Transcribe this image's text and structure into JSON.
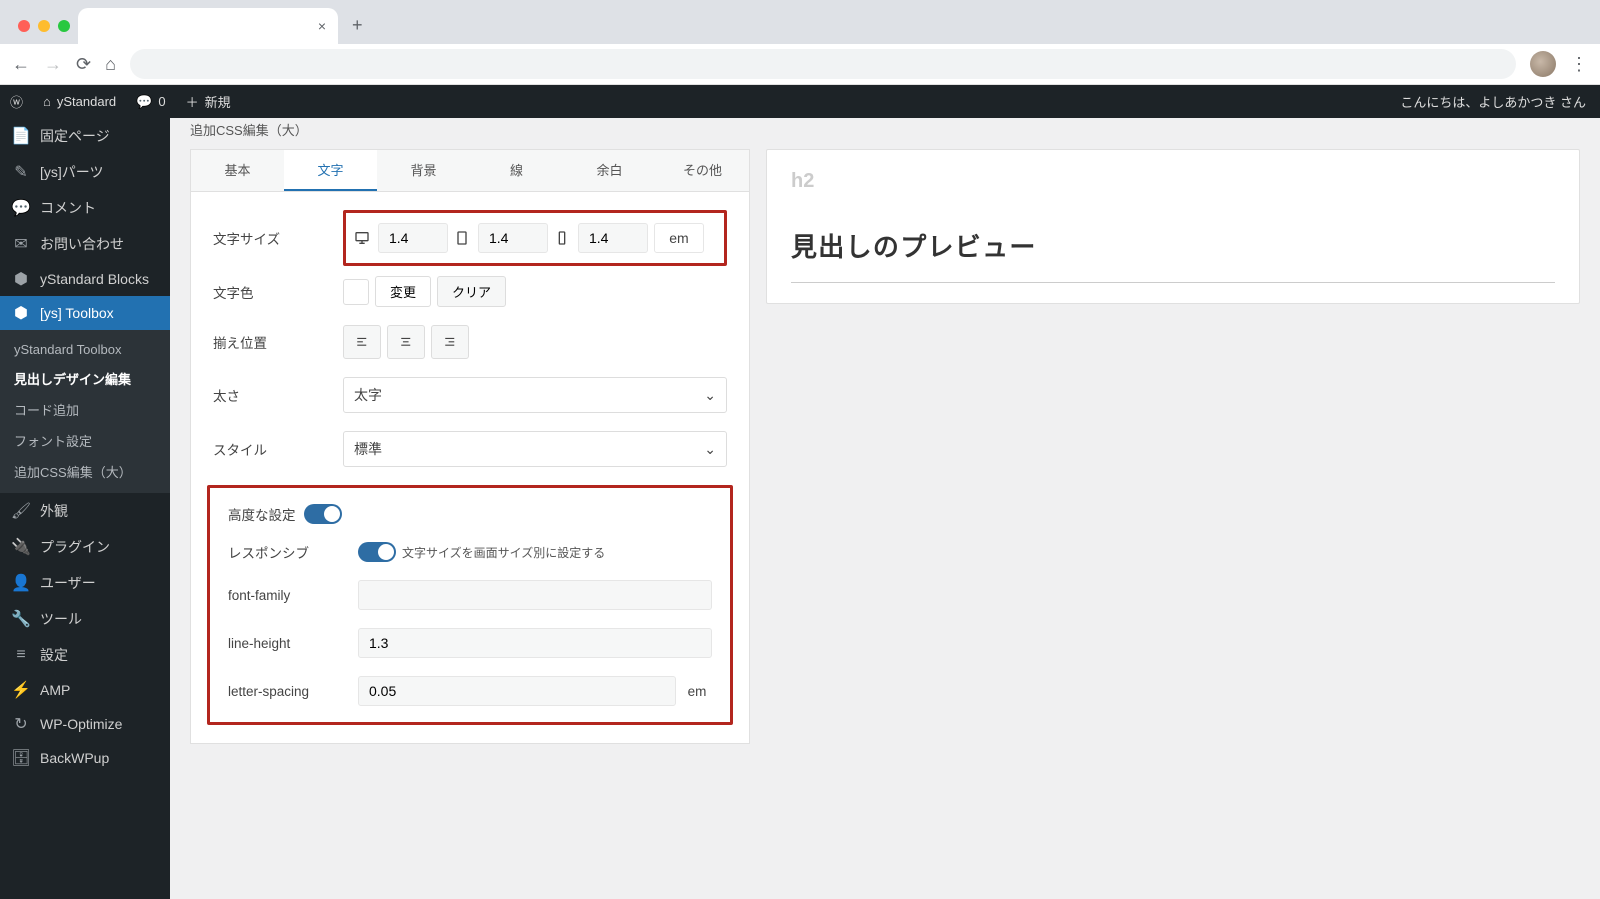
{
  "browser": {
    "close_tooltip": "×",
    "plus_tooltip": "+"
  },
  "wpbar": {
    "site": "yStandard",
    "comments": "0",
    "new": "新規",
    "greeting": "こんにちは、よしあかつき さん"
  },
  "sidebar": {
    "items": [
      {
        "icon": "page",
        "label": "固定ページ"
      },
      {
        "icon": "puzzle",
        "label": "[ys]パーツ"
      },
      {
        "icon": "comment",
        "label": "コメント"
      },
      {
        "icon": "mail",
        "label": "お問い合わせ"
      },
      {
        "icon": "cube",
        "label": "yStandard Blocks"
      },
      {
        "icon": "cube",
        "label": "[ys] Toolbox",
        "active": true
      },
      {
        "icon": "brush",
        "label": "外観"
      },
      {
        "icon": "plugin",
        "label": "プラグイン"
      },
      {
        "icon": "user",
        "label": "ユーザー"
      },
      {
        "icon": "wrench",
        "label": "ツール"
      },
      {
        "icon": "sliders",
        "label": "設定"
      },
      {
        "icon": "bolt",
        "label": "AMP"
      },
      {
        "icon": "refresh",
        "label": "WP-Optimize"
      },
      {
        "icon": "db",
        "label": "BackWPup"
      }
    ],
    "sub": [
      {
        "label": "yStandard Toolbox"
      },
      {
        "label": "見出しデザイン編集",
        "active": true
      },
      {
        "label": "コード追加"
      },
      {
        "label": "フォント設定"
      },
      {
        "label": "追加CSS編集（大）"
      }
    ]
  },
  "crumb": "追加CSS編集（大）",
  "tabs": [
    "基本",
    "文字",
    "背景",
    "線",
    "余白",
    "その他"
  ],
  "active_tab": 1,
  "fields": {
    "font_size": {
      "label": "文字サイズ",
      "desktop": "1.4",
      "tablet": "1.4",
      "mobile": "1.4",
      "unit": "em"
    },
    "color": {
      "label": "文字色",
      "change": "変更",
      "clear": "クリア"
    },
    "align": {
      "label": "揃え位置"
    },
    "weight": {
      "label": "太さ",
      "value": "太字"
    },
    "style": {
      "label": "スタイル",
      "value": "標準"
    },
    "advanced": {
      "label": "高度な設定"
    },
    "responsive": {
      "label": "レスポンシブ",
      "hint": "文字サイズを画面サイズ別に設定する"
    },
    "font_family": {
      "label": "font-family",
      "value": ""
    },
    "line_height": {
      "label": "line-height",
      "value": "1.3"
    },
    "letter_spacing": {
      "label": "letter-spacing",
      "value": "0.05",
      "unit": "em"
    }
  },
  "preview": {
    "tag": "h2",
    "text": "見出しのプレビュー"
  }
}
